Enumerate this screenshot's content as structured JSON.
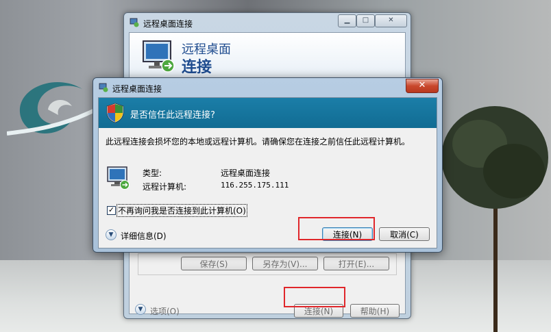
{
  "back_window": {
    "title": "远程桌面连接",
    "header_line1": "远程桌面",
    "header_line2": "连接",
    "buttons": {
      "save": "保存(S)",
      "save_as": "另存为(V)...",
      "open": "打开(E)...",
      "connect": "连接(N)",
      "help": "帮助(H)"
    },
    "options_label": "选项(O)"
  },
  "dialog": {
    "title": "远程桌面连接",
    "close_glyph": "✕",
    "banner_text": "是否信任此远程连接?",
    "message": "此远程连接会损坏您的本地或远程计算机。请确保您在连接之前信任此远程计算机。",
    "info": {
      "type_label": "类型:",
      "type_value": "远程桌面连接",
      "computer_label": "远程计算机:",
      "computer_value": "116.255.175.111"
    },
    "checkbox": {
      "label": "不再询问我是否连接到此计算机(O)",
      "checked": true,
      "check_glyph": "✓"
    },
    "details_label": "详细信息(D)",
    "expand_glyph": "▼",
    "buttons": {
      "connect": "连接(N)",
      "cancel": "取消(C)"
    }
  },
  "colors": {
    "banner": "#1b7ea8",
    "highlight": "#e0262a",
    "header_text": "#1f4c8f"
  }
}
